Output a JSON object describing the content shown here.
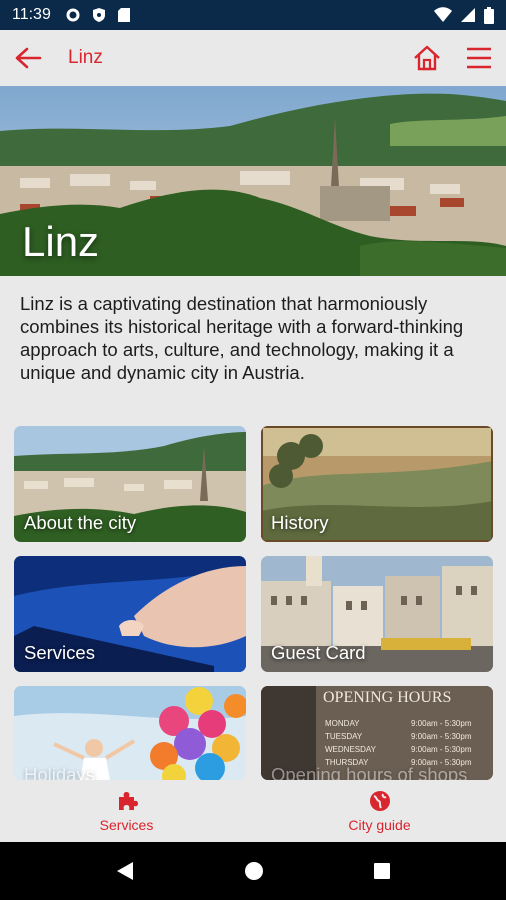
{
  "status": {
    "time": "11:39"
  },
  "appbar": {
    "title": "Linz"
  },
  "hero": {
    "title": "Linz"
  },
  "intro": {
    "text": "Linz is a captivating destination that harmoniously combines its historical heritage with a forward-thinking approach to arts, culture, and technology, making it a unique and dynamic city in Austria."
  },
  "tiles": [
    {
      "label": "About the city"
    },
    {
      "label": "History"
    },
    {
      "label": "Services"
    },
    {
      "label": "Guest Card"
    },
    {
      "label": "Holidays"
    },
    {
      "label": "Opening hours of shops"
    }
  ],
  "opening_sign": {
    "heading": "OPENING HOURS",
    "days": [
      "MONDAY",
      "TUESDAY",
      "WEDNESDAY",
      "THURSDAY"
    ],
    "hours": [
      "9:00am - 5:30pm",
      "9:00am - 5:30pm",
      "9:00am - 5:30pm",
      "9:00am - 5:30pm"
    ]
  },
  "bottomnav": {
    "services": "Services",
    "city_guide": "City guide"
  },
  "colors": {
    "accent": "#d9252d",
    "statusbar": "#0b2a4a",
    "background": "#e9e9e9"
  }
}
